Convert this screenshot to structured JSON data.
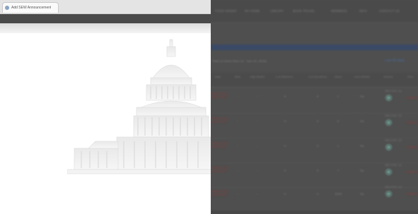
{
  "browser": {
    "tab_title": "Add SEW Announcement"
  },
  "nav": {
    "items": [
      "FOOD ORDER",
      "MY HOME",
      "LIBRARY",
      "BOOK TRAVEL",
      "MEMBERS",
      "INFO",
      "CONTACT US"
    ]
  },
  "summary": {
    "line": "Total 12 items (Nov 12 - Nov 24, 2024)",
    "link": "Last 60 days"
  },
  "table": {
    "columns": [
      "Date",
      "Bids",
      "High Bidder",
      "# of Watchers",
      "# of Questions",
      "Views",
      "Auto-Relists",
      "Actions",
      "Time"
    ],
    "rows": [
      {
        "date": "2024-11-12 09:13 PST",
        "bids": "--",
        "high": "--",
        "watchers": "0",
        "questions": "0",
        "views": "1",
        "relists": "No",
        "sub": "SEE ETA: 1/1",
        "tail": "ORDER"
      },
      {
        "date": "2024-11-13 10:21 PST",
        "bids": "--",
        "high": "--",
        "watchers": "0",
        "questions": "0",
        "views": "0",
        "relists": "No",
        "sub": "SEE ETA: 1/1",
        "tail": "ORDER"
      },
      {
        "date": "2024-11-15 08:40 PST",
        "bids": "--",
        "high": "--",
        "watchers": "0",
        "questions": "0",
        "views": "1",
        "relists": "No",
        "sub": "SEE ETA: 1/1",
        "tail": "ORDER"
      },
      {
        "date": "2024-11-19 11:02 PST",
        "bids": "--",
        "high": "--",
        "watchers": "0",
        "questions": "0",
        "views": "7",
        "relists": "No",
        "sub": "SEE ETA: 1/1",
        "tail": "ORDER"
      },
      {
        "date": "2024-11-22 13:30 PST",
        "bids": "--",
        "high": "--",
        "watchers": "0",
        "questions": "0",
        "views": "1028",
        "relists": "No",
        "sub": "SEE ETA: 1/1",
        "tail": "ORDER"
      }
    ]
  },
  "colors": {
    "overlay": "#4f4f4f",
    "accent_band": "#3a4a66",
    "date_text": "#8a3b3b"
  },
  "icons": {
    "action": "circle-action-icon",
    "capitol": "capitol-building-image"
  }
}
